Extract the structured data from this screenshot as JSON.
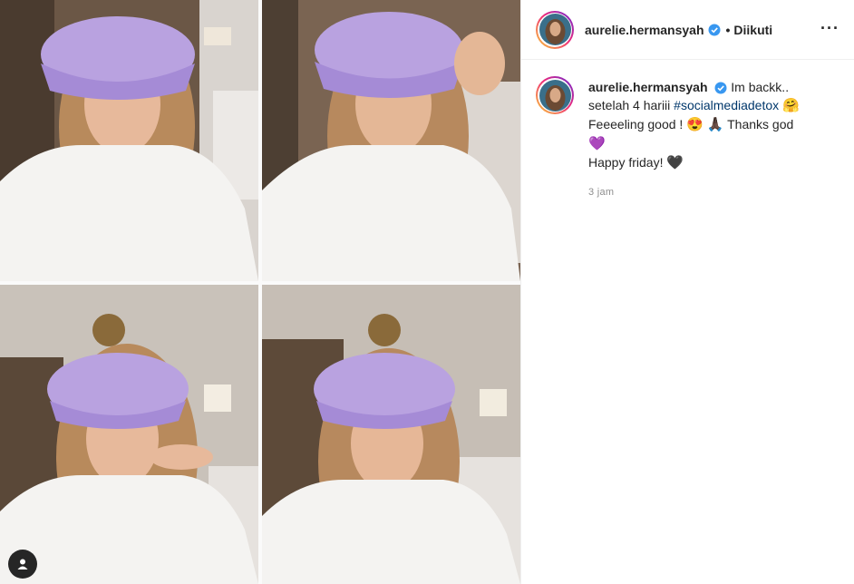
{
  "post": {
    "username": "aurelie.hermansyah",
    "follow_status": "Diikuti",
    "separator": "•",
    "more_icon": "···",
    "caption": {
      "line1_text": "Im backk..",
      "line2_text": "setelah 4 hariii",
      "hashtag": "#socialmediadetox",
      "emoji1": "🤗",
      "line3_text": "Feeeeling good !",
      "emoji2": "😍",
      "emoji3": "🙏🏿",
      "line3_tail": "Thanks god",
      "emoji4": "💜",
      "line4_text": "Happy friday!",
      "emoji5": "🖤"
    },
    "timestamp": "3 jam"
  },
  "icons": {
    "verified": "verified-badge-icon",
    "user_tag": "user-tag-icon",
    "more": "more-options-icon"
  },
  "colors": {
    "verified_blue": "#3897f0",
    "hashtag": "#00376b",
    "timestamp": "#8e8e8e",
    "hat_lilac": "#b9a2e0"
  }
}
